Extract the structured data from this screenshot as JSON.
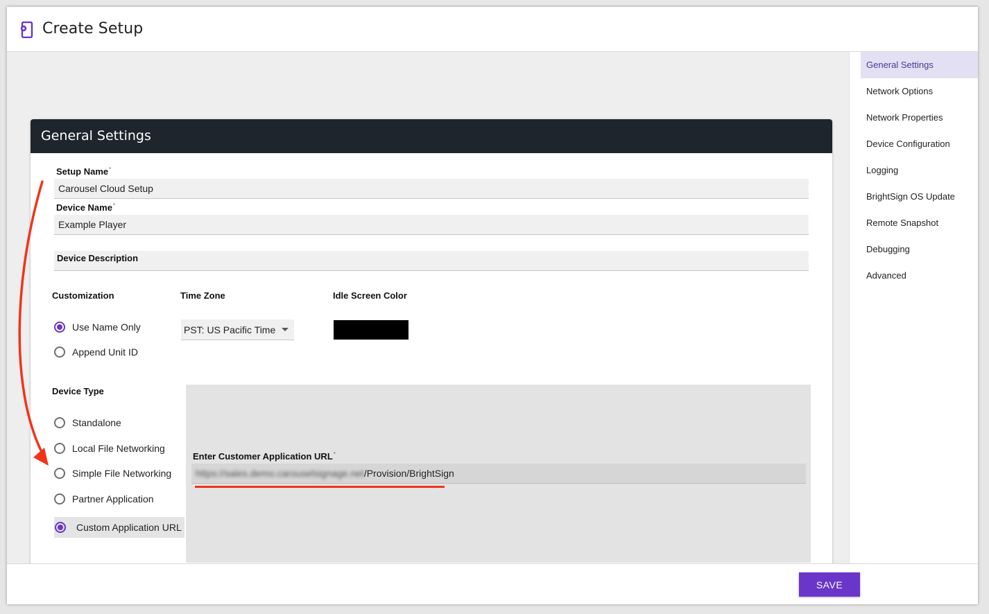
{
  "window": {
    "title": "Create Setup"
  },
  "card": {
    "title": "General Settings",
    "setup_name": {
      "label": "Setup Name",
      "required": "*",
      "value": "Carousel Cloud Setup"
    },
    "device_name": {
      "label": "Device Name",
      "required": "*",
      "value": "Example Player"
    },
    "device_description": {
      "label": "Device Description",
      "value": ""
    },
    "customization": {
      "label": "Customization",
      "options": [
        "Use Name Only",
        "Append Unit ID"
      ],
      "selected": "Use Name Only"
    },
    "time_zone": {
      "label": "Time Zone",
      "value": "PST: US Pacific Time"
    },
    "idle_screen_color": {
      "label": "Idle Screen Color",
      "value": "#000000"
    },
    "device_type": {
      "label": "Device Type",
      "options": [
        "Standalone",
        "Local File Networking",
        "Simple File Networking",
        "Partner Application",
        "Custom Application URL"
      ],
      "selected": "Custom Application URL"
    },
    "customer_url": {
      "label": "Enter Customer Application URL",
      "required": "*",
      "value_blurred": "https://sales.demo.carouselsignage.net",
      "value_visible": "/Provision/BrightSign"
    }
  },
  "sidenav": {
    "items": [
      "General Settings",
      "Network Options",
      "Network Properties",
      "Device Configuration",
      "Logging",
      "BrightSign OS Update",
      "Remote Snapshot",
      "Debugging",
      "Advanced"
    ],
    "active": "General Settings"
  },
  "footer": {
    "save_label": "SAVE"
  },
  "colors": {
    "accent": "#6a35c9",
    "header_bg": "#1e252c",
    "annotation": "#f0341c"
  },
  "icons": {
    "app": "device-gear-icon",
    "select_caret": "caret-down-icon"
  }
}
